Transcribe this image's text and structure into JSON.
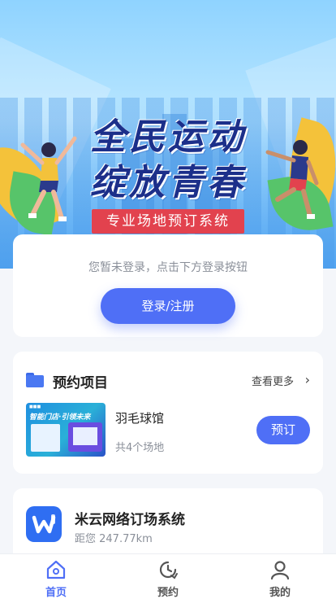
{
  "banner": {
    "title_line1": "全民运动",
    "title_line2": "绽放青春",
    "tagline": "专业场地预订系统"
  },
  "login": {
    "hint": "您暂未登录，点击下方登录按钮",
    "button_label": "登录/注册"
  },
  "booking": {
    "section_title": "预约项目",
    "more_label": "查看更多",
    "thumb_text": "智能门店·引领未来",
    "items": [
      {
        "name": "羽毛球馆",
        "count": "共4个场地",
        "button_label": "预订"
      }
    ]
  },
  "venue": {
    "name": "米云网络订场系统",
    "distance": "距您 247.77km"
  },
  "tabbar": {
    "items": [
      {
        "label": "首页",
        "icon": "home-icon",
        "active": true
      },
      {
        "label": "预约",
        "icon": "clock-icon",
        "active": false
      },
      {
        "label": "我的",
        "icon": "user-icon",
        "active": false
      }
    ]
  },
  "colors": {
    "accent": "#4f6ff6",
    "tag_red": "#e2424e",
    "title_navy": "#1c2f8a",
    "background": "#f4f6fa"
  }
}
